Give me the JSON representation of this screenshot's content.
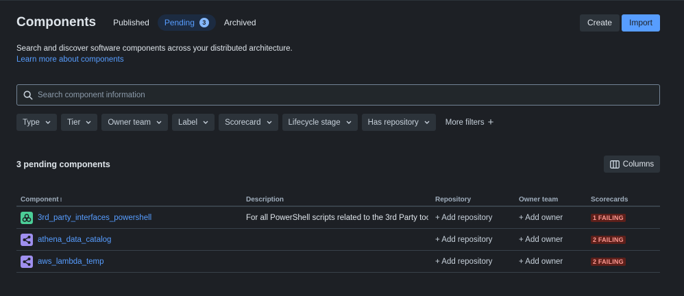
{
  "header": {
    "title": "Components",
    "tabs": [
      {
        "label": "Published"
      },
      {
        "label": "Pending",
        "count": "3"
      },
      {
        "label": "Archived"
      }
    ],
    "create_label": "Create",
    "import_label": "Import"
  },
  "intro": {
    "description": "Search and discover software components across your distributed architecture.",
    "learn_more": "Learn more about components"
  },
  "search": {
    "placeholder": "Search component information",
    "icon": "search-icon"
  },
  "filters": {
    "items": [
      "Type",
      "Tier",
      "Owner team",
      "Label",
      "Scorecard",
      "Lifecycle stage",
      "Has repository"
    ],
    "more_label": "More filters"
  },
  "results": {
    "count_label": "3 pending components",
    "columns_label": "Columns"
  },
  "table": {
    "headers": {
      "component": "Component",
      "description": "Description",
      "repository": "Repository",
      "owner_team": "Owner team",
      "scorecards": "Scorecards"
    },
    "rows": [
      {
        "name": "3rd_party_interfaces_powershell",
        "icon": "group-icon",
        "icon_color": "#4bce97",
        "description": "For all PowerShell scripts related to the 3rd Party too...",
        "repository": "+ Add repository",
        "owner": "+ Add owner",
        "scorecard": "1 FAILING"
      },
      {
        "name": "athena_data_catalog",
        "icon": "share-icon",
        "icon_color": "#9f8fef",
        "description": "",
        "repository": "+ Add repository",
        "owner": "+ Add owner",
        "scorecard": "2 FAILING"
      },
      {
        "name": "aws_lambda_temp",
        "icon": "share-icon",
        "icon_color": "#9f8fef",
        "description": "",
        "repository": "+ Add repository",
        "owner": "+ Add owner",
        "scorecard": "2 FAILING"
      }
    ]
  },
  "colors": {
    "background": "#1d2025",
    "accent": "#579dff",
    "failing_bg": "#5d1f1a",
    "failing_text": "#fd9891"
  }
}
